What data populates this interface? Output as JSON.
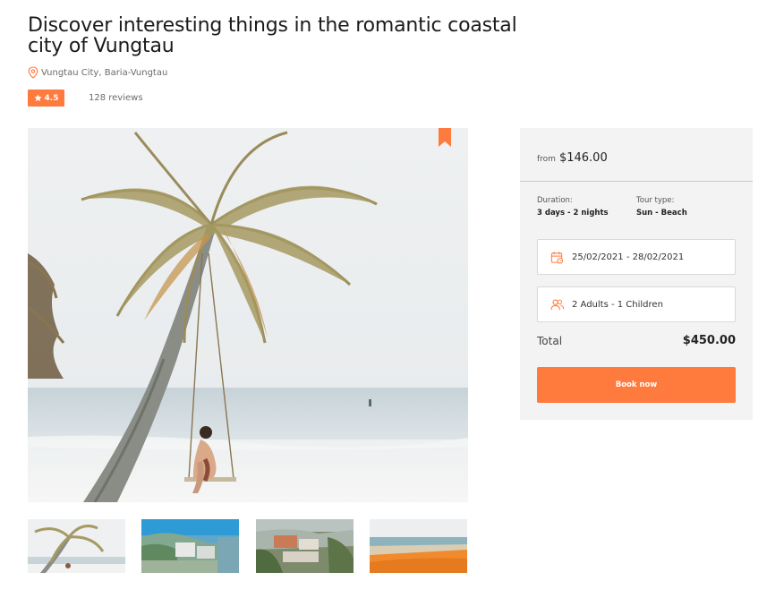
{
  "tour": {
    "title": "Discover interesting things in the romantic coastal city of Vungtau",
    "location": "Vungtau City, Baria-Vungtau",
    "rating": "4.5",
    "reviews": "128 reviews"
  },
  "gallery": {
    "main_image": "palm-tree-swing-beach",
    "thumbnails": [
      "palm-tree-beach",
      "coastal-hill-town",
      "seaside-village",
      "orange-sand-beach"
    ]
  },
  "booking": {
    "price_prefix": "from",
    "price": "$146.00",
    "duration_label": "Duration:",
    "duration_value": "3 days - 2 nights",
    "tour_type_label": "Tour type:",
    "tour_type_value": "Sun - Beach",
    "date_range": "25/02/2021 - 28/02/2021",
    "guests": "2 Adults - 1 Children",
    "total_label": "Total",
    "total_value": "$450.00",
    "book_label": "Book now"
  },
  "colors": {
    "accent": "#ff7a3d",
    "panel_bg": "#f3f3f3"
  },
  "icons": {
    "location": "map-pin-icon",
    "rating": "star-icon",
    "bookmark": "bookmark-icon",
    "date": "calendar-icon",
    "guests": "users-icon"
  }
}
